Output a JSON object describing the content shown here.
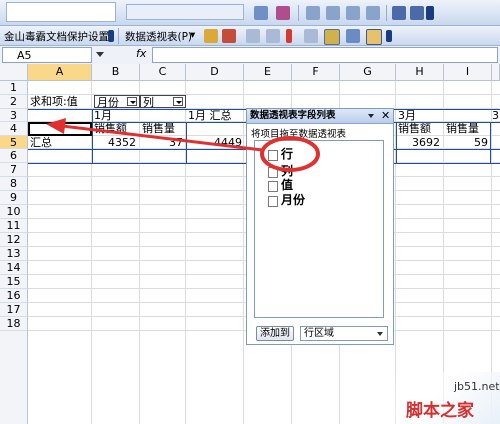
{
  "toolbar_top": {
    "icons": [
      "bold-icon",
      "chart-icon",
      "align-left-icon",
      "align-center-icon",
      "align-right-icon",
      "merge-icon",
      "indent-icon",
      "outdent-icon"
    ]
  },
  "toolbar_second": {
    "protect_button_label": "金山毒霸文档保护设置",
    "pivot_menu_label": "数据透视表(P)",
    "pivot_menu_arrow": "▾"
  },
  "formula_bar": {
    "name_box_value": "A5",
    "fx_label": "fx",
    "formula_value": ""
  },
  "columns": [
    "A",
    "B",
    "C",
    "D",
    "E",
    "F",
    "G",
    "H",
    "I"
  ],
  "rows": [
    "1",
    "2",
    "3",
    "4",
    "5",
    "6",
    "7",
    "8",
    "9",
    "10",
    "11",
    "12",
    "13",
    "14",
    "15",
    "16",
    "17",
    "18"
  ],
  "pivot_table": {
    "corner_label": "求和项:值",
    "col_field_month": "月份",
    "col_field_col": "列",
    "month1": "1月",
    "month1_total": "1月 汇总",
    "month3": "3月",
    "col_3_clipped": "3",
    "sales_amount": "销售额",
    "sales_qty": "销售量",
    "total_label": "汇总",
    "values": {
      "b6": "4352",
      "c6": "37",
      "d6": "4449",
      "h6": "3692",
      "i6": "59"
    }
  },
  "field_list": {
    "title": "数据透视表字段列表",
    "instruction": "将项目拖至数据透视表",
    "fields": [
      "行",
      "列",
      "值",
      "月份"
    ],
    "add_button_label": "添加到",
    "area_select_value": "行区域",
    "highlight_color": "#e03030"
  },
  "watermark": {
    "site": "jb51.net",
    "brand": "脚本之家"
  },
  "colors": {
    "selection": "#1f4e9c",
    "annotation": "#e03030"
  }
}
